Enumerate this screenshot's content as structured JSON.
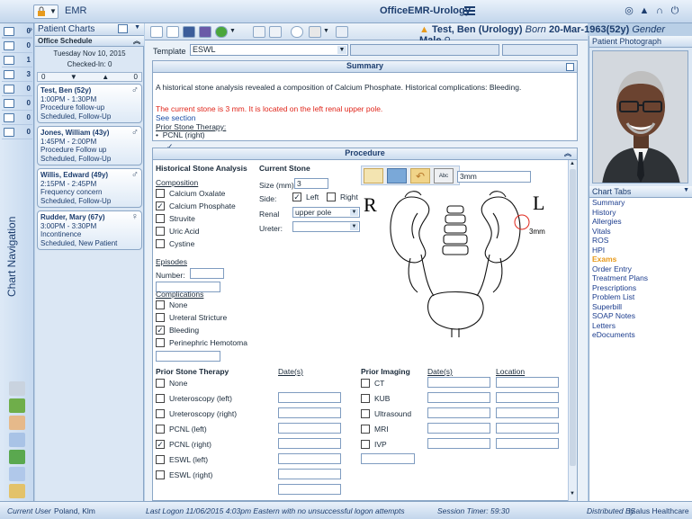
{
  "app": {
    "name": "EMR",
    "title": "OfficeEMR-Urology"
  },
  "patient_banner": {
    "name": "Test, Ben (Urology)",
    "born_label": "Born",
    "born": "20-Mar-1963(52y)",
    "gender_label": "Gender",
    "gender": "Male"
  },
  "left_nav": {
    "label": "Chart Navigation",
    "counts": [
      "0",
      "0",
      "1",
      "3",
      "0",
      "0",
      "0",
      "0"
    ]
  },
  "patient_charts": {
    "title": "Patient Charts",
    "schedule_title": "Office Schedule",
    "date": "Tuesday Nov 10, 2015",
    "checked_in": "Checked-In: 0",
    "count_left": "0",
    "count_right": "0",
    "cards": [
      {
        "name": "Test, Ben (52y)",
        "time": "1:00PM - 1:30PM",
        "reason": "Procedure follow-up",
        "status": "Scheduled, Follow-Up",
        "gender": "♂"
      },
      {
        "name": "Jones, William (43y)",
        "time": "1:45PM - 2:00PM",
        "reason": "Procedure Follow up",
        "status": "Scheduled, Follow-Up",
        "gender": "♂"
      },
      {
        "name": "Willis, Edward (49y)",
        "time": "2:15PM - 2:45PM",
        "reason": "Frequency concern",
        "status": "Scheduled, Follow-Up",
        "gender": "♂"
      },
      {
        "name": "Rudder, Mary (67y)",
        "time": "3:00PM - 3:30PM",
        "reason": "Incontinence",
        "status": "Scheduled, New Patient",
        "gender": "♀"
      }
    ]
  },
  "template": {
    "label": "Template",
    "value": "ESWL"
  },
  "summary": {
    "title": "Summary",
    "line1": "A historical stone analysis revealed a composition of Calcium Phosphate. Historical complications: Bleeding.",
    "line2": "The current stone is 3 mm. It is located on the left renal upper pole.",
    "see_section": "See section",
    "prior_title": "Prior Stone Therapy:",
    "prior_item": "PCNL (right)"
  },
  "procedure": {
    "title": "Procedure",
    "historical_title": "Historical Stone Analysis",
    "composition_title": "Composition",
    "composition": [
      {
        "label": "Calcium Oxalate",
        "checked": false
      },
      {
        "label": "Calcium Phosphate",
        "checked": true
      },
      {
        "label": "Struvite",
        "checked": false
      },
      {
        "label": "Uric Acid",
        "checked": false
      },
      {
        "label": "Cystine",
        "checked": false
      }
    ],
    "episodes_title": "Episodes",
    "number_label": "Number:",
    "complications_title": "Complications",
    "complications": [
      {
        "label": "None",
        "checked": false
      },
      {
        "label": "Ureteral Stricture",
        "checked": false
      },
      {
        "label": "Bleeding",
        "checked": true
      },
      {
        "label": "Perinephric Hemotoma",
        "checked": false
      }
    ],
    "current_title": "Current Stone",
    "size_label": "Size (mm):",
    "size_value": "3",
    "side_label": "Side:",
    "side_left": "Left",
    "side_right": "Right",
    "renal_label": "Renal",
    "renal_value": "upper pole",
    "ureter_label": "Ureter:",
    "ureter_value": "",
    "drawing_text": "3mm",
    "drawing_R": "R",
    "drawing_L": "L",
    "drawing_annot": "3mm",
    "prior_therapy_title": "Prior Stone Therapy",
    "dates_label": "Date(s)",
    "prior_therapy": [
      {
        "label": "None",
        "checked": false
      },
      {
        "label": "Ureteroscopy (left)",
        "checked": false
      },
      {
        "label": "Ureteroscopy (right)",
        "checked": false
      },
      {
        "label": "PCNL (left)",
        "checked": false
      },
      {
        "label": "PCNL (right)",
        "checked": true
      },
      {
        "label": "ESWL (left)",
        "checked": false
      },
      {
        "label": "ESWL (right)",
        "checked": false
      }
    ],
    "prior_imaging_title": "Prior Imaging",
    "imaging_dates_label": "Date(s)",
    "location_label": "Location",
    "imaging": [
      {
        "label": "CT",
        "checked": false
      },
      {
        "label": "KUB",
        "checked": false
      },
      {
        "label": "Ultrasound",
        "checked": false
      },
      {
        "label": "MRI",
        "checked": false
      },
      {
        "label": "IVP",
        "checked": false
      }
    ]
  },
  "right_panel": {
    "photo_title": "Patient Photograph",
    "tabs_title": "Chart Tabs",
    "tabs": [
      "Summary",
      "History",
      "Allergies",
      "Vitals",
      "ROS",
      "HPI",
      "Exams",
      "Order Entry",
      "Treatment Plans",
      "Prescriptions",
      "Problem List",
      "Superbill",
      "SOAP Notes",
      "Letters",
      "eDocuments"
    ],
    "active_tab": "Exams"
  },
  "status": {
    "user_label": "Current User",
    "user": "Poland, Klm",
    "last_logon": "Last Logon  11/06/2015 4:03pm Eastern  with no unsuccessful logon attempts",
    "timer": "Session Timer: 59:30",
    "distributed_label": "Distributed By",
    "distributed": "iSalus Healthcare"
  },
  "colors": {
    "accent": "#1c3d6e",
    "alert_text": "#e0261b",
    "link": "#1c4fa6",
    "active_tab": "#e79a1c"
  }
}
